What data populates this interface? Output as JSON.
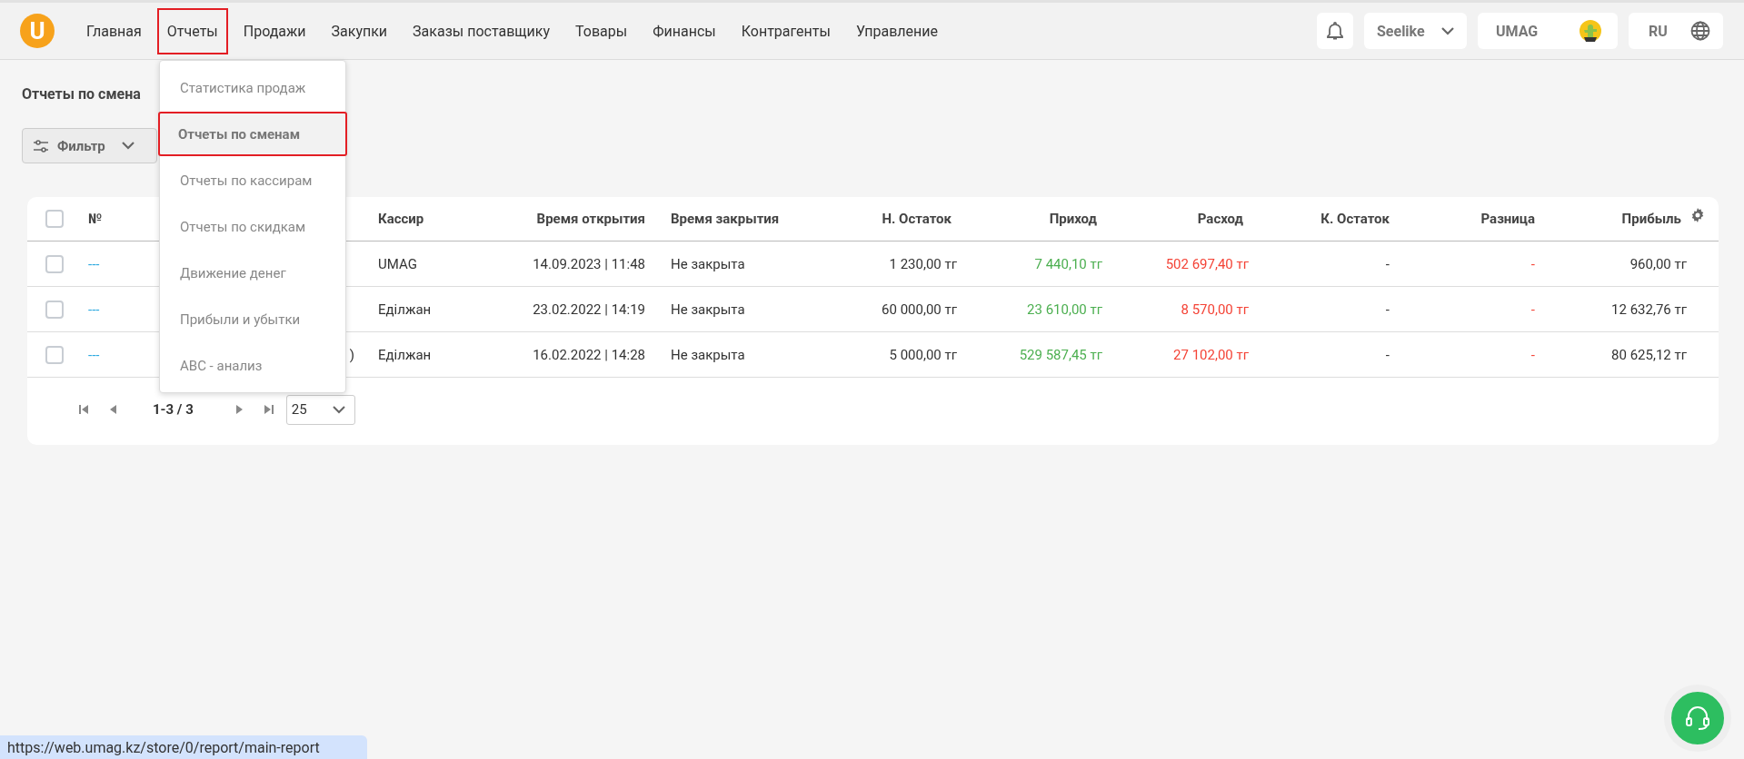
{
  "logo": "U",
  "nav": {
    "items": [
      {
        "label": "Главная",
        "highlighted": false
      },
      {
        "label": "Отчеты",
        "highlighted": true
      },
      {
        "label": "Продажи",
        "highlighted": false
      },
      {
        "label": "Закупки",
        "highlighted": false
      },
      {
        "label": "Заказы поставщику",
        "highlighted": false
      },
      {
        "label": "Товары",
        "highlighted": false
      },
      {
        "label": "Финансы",
        "highlighted": false
      },
      {
        "label": "Контрагенты",
        "highlighted": false
      },
      {
        "label": "Управление",
        "highlighted": false
      }
    ]
  },
  "header_controls": {
    "store": "Seelike",
    "user": "UMAG",
    "language": "RU"
  },
  "reports_menu": {
    "items": [
      {
        "label": "Статистика продаж",
        "selected": false,
        "highlighted": false
      },
      {
        "label": "Отчеты по сменам",
        "selected": true,
        "highlighted": true
      },
      {
        "label": "Отчеты по кассирам",
        "selected": false,
        "highlighted": false
      },
      {
        "label": "Отчеты по скидкам",
        "selected": false,
        "highlighted": false
      },
      {
        "label": "Движение денег",
        "selected": false,
        "highlighted": false
      },
      {
        "label": "Прибыли и убытки",
        "selected": false,
        "highlighted": false
      },
      {
        "label": "ABC - анализ",
        "selected": false,
        "highlighted": false
      }
    ]
  },
  "page_title": "Отчеты по смена",
  "filter_button": "Фильтр",
  "table": {
    "all_checked": false,
    "columns": {
      "number": "№",
      "cashier": "Кассир",
      "opened": "Время открытия",
      "closed": "Время закрытия",
      "opening_balance": "Н. Остаток",
      "income": "Приход",
      "expense": "Расход",
      "closing_balance": "К. Остаток",
      "difference": "Разница",
      "profit": "Прибыль"
    },
    "rows": [
      {
        "checked": false,
        "number": "---",
        "cashier": "UMAG",
        "opened": "14.09.2023 | 11:48",
        "closed": "Не закрыта",
        "opening_balance": "1 230,00 тг",
        "income": "7 440,10 тг",
        "expense": "502 697,40 тг",
        "closing_balance": "-",
        "difference": "-",
        "profit": "960,00 тг"
      },
      {
        "checked": false,
        "number": "---",
        "cashier": "Еділжан",
        "opened": "23.02.2022 | 14:19",
        "closed": "Не закрыта",
        "opening_balance": "60 000,00 тг",
        "income": "23 610,00 тг",
        "expense": "8 570,00 тг",
        "closing_balance": "-",
        "difference": "-",
        "profit": "12 632,76 тг"
      },
      {
        "checked": false,
        "number": "---",
        "column_3": ")",
        "cashier": "Еділжан",
        "opened": "16.02.2022 | 14:28",
        "closed": "Не закрыта",
        "opening_balance": "5 000,00 тг",
        "income": "529 587,45 тг",
        "expense": "27 102,00 тг",
        "closing_balance": "-",
        "difference": "-",
        "profit": "80 625,12 тг"
      }
    ]
  },
  "pagination": {
    "range": "1-3 / 3",
    "page_size": "25"
  },
  "status_url": "https://web.umag.kz/store/0/report/main-report"
}
